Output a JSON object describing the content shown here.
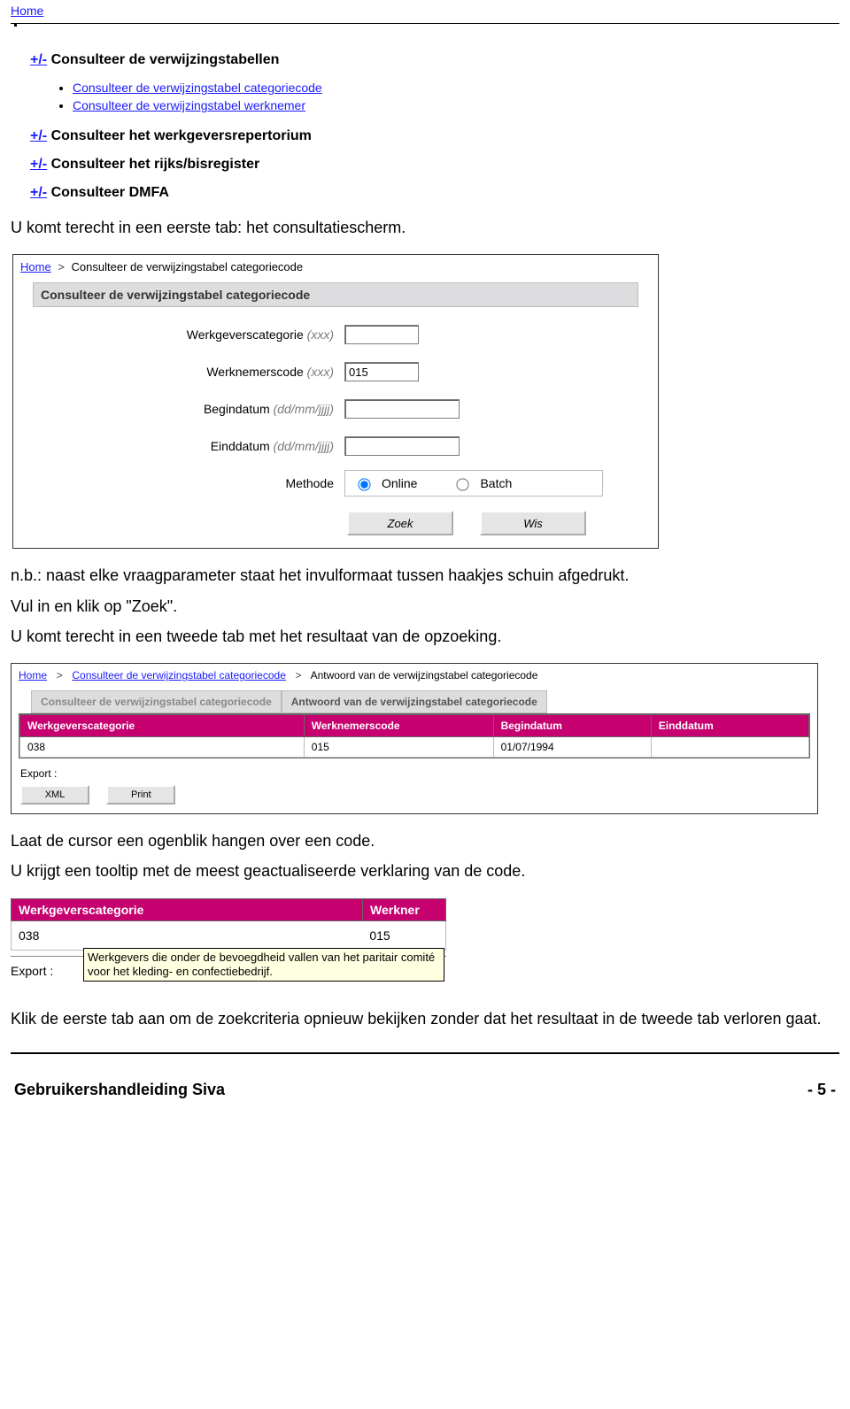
{
  "home_link": "Home",
  "nav": {
    "row1": {
      "toggle": "+/-",
      "title": "Consulteer de verwijzingstabellen"
    },
    "sub": [
      "Consulteer de verwijzingstabel categoriecode",
      "Consulteer de verwijzingstabel werknemer"
    ],
    "row2": {
      "toggle": "+/-",
      "title": "Consulteer het werkgeversrepertorium"
    },
    "row3": {
      "toggle": "+/-",
      "title": "Consulteer het rijks/bisregister"
    },
    "row4": {
      "toggle": "+/-",
      "title": "Consulteer DMFA"
    }
  },
  "p1": "U komt terecht in een eerste tab: het consultatiescherm.",
  "shot2": {
    "bc_home": "Home",
    "bc_sep": ">",
    "bc_current": "Consulteer de verwijzingstabel categoriecode",
    "panel_title": "Consulteer de verwijzingstabel categoriecode",
    "fields": {
      "f1": {
        "label": "Werkgeverscategorie",
        "hint": "(xxx)",
        "value": ""
      },
      "f2": {
        "label": "Werknemerscode",
        "hint": "(xxx)",
        "value": "015"
      },
      "f3": {
        "label": "Begindatum",
        "hint": "(dd/mm/jjjj)",
        "value": ""
      },
      "f4": {
        "label": "Einddatum",
        "hint": "(dd/mm/jjjj)",
        "value": ""
      },
      "f5": {
        "label": "Methode"
      }
    },
    "radios": {
      "online": "Online",
      "batch": "Batch",
      "selected": "online"
    },
    "buttons": {
      "zoek": "Zoek",
      "wis": "Wis"
    }
  },
  "p2": "n.b.: naast elke vraagparameter staat het invulformaat tussen haakjes schuin afgedrukt.",
  "p3": "Vul in en klik op \"Zoek\".",
  "p4": "U komt terecht in een tweede tab met het resultaat van de opzoeking.",
  "shot3": {
    "bc_home": "Home",
    "bc_link2": "Consulteer de verwijzingstabel categoriecode",
    "bc_current": "Antwoord van de verwijzingstabel categoriecode",
    "tabs": {
      "t1": "Consulteer de verwijzingstabel categoriecode",
      "t2": "Antwoord van de verwijzingstabel categoriecode"
    },
    "columns": {
      "c1": "Werkgeverscategorie",
      "c2": "Werknemerscode",
      "c3": "Begindatum",
      "c4": "Einddatum"
    },
    "row": {
      "c1": "038",
      "c2": "015",
      "c3": "01/07/1994",
      "c4": ""
    },
    "export_label": "Export :",
    "btn_xml": "XML",
    "btn_print": "Print"
  },
  "p5": "Laat de cursor een ogenblik hangen over een code.",
  "p6": "U krijgt een tooltip met de meest geactualiseerde verklaring van de code.",
  "shot4": {
    "th1": "Werkgeverscategorie",
    "th2": "Werkner",
    "td1": "038",
    "td2": "015",
    "export_clip": "Export :",
    "tooltip": "Werkgevers die onder de bevoegdheid vallen van het paritair comité voor het kleding- en confectiebedrijf."
  },
  "p7": "Klik de eerste tab aan om de zoekcriteria opnieuw bekijken zonder dat het resultaat in de tweede tab verloren gaat.",
  "footer": {
    "left": "Gebruikershandleiding Siva",
    "right": "- 5 -"
  }
}
